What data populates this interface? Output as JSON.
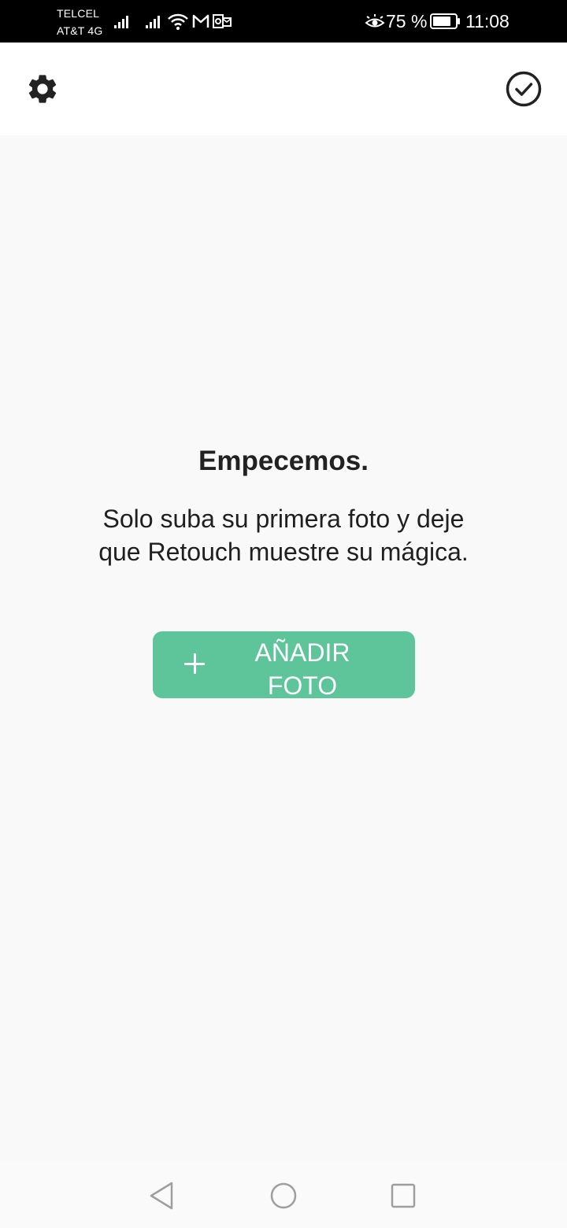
{
  "status_bar": {
    "carrier_primary": "TELCEL",
    "carrier_secondary": "AT&T 4G",
    "battery_percent": "75 %",
    "time": "11:08",
    "icons": [
      "signal-icon",
      "signal-icon",
      "wifi-icon",
      "gmail-icon",
      "outlook-icon",
      "eye-comfort-icon",
      "battery-icon"
    ]
  },
  "header": {
    "left_icon": "gear-icon",
    "right_icon": "check-circle-icon"
  },
  "empty_state": {
    "title": "Empecemos.",
    "message": "Solo suba su primera foto y deje que Retouch muestre su mágica.",
    "button": {
      "icon": "plus-icon",
      "label": "AÑADIR FOTO"
    }
  },
  "nav_bar": {
    "icons": [
      "back-icon",
      "home-icon",
      "recents-icon"
    ]
  },
  "colors": {
    "accent": "#5ec49a",
    "status_bar_bg": "#000000",
    "header_bg": "#ffffff",
    "content_bg": "#f9f9f9",
    "text": "#222222"
  }
}
